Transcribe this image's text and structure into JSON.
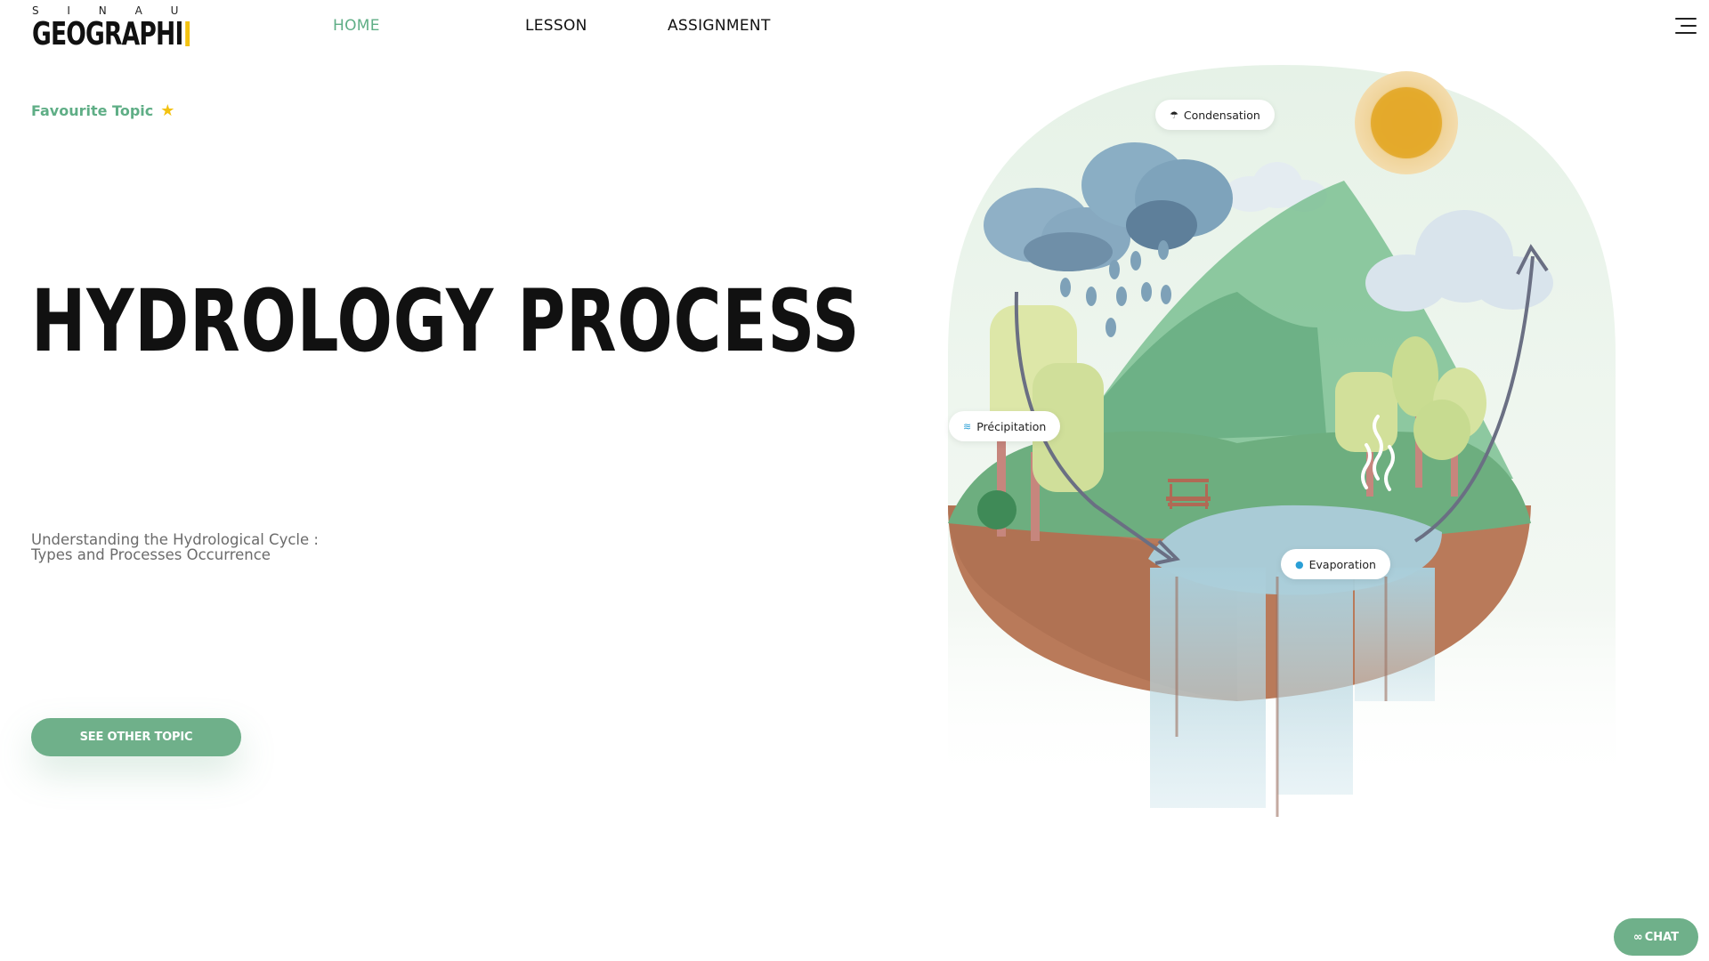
{
  "brand": {
    "top": "S I N A U",
    "main": "GEOGRAPHI"
  },
  "nav": {
    "items": [
      "HOME",
      "LESSON",
      "ASSIGNMENT"
    ],
    "active": "HOME"
  },
  "favourite": {
    "label": "Favourite Topic",
    "icon": "star-icon"
  },
  "hero": {
    "title": "HYDROLOGY PROCESS",
    "subtitle_line1": "Understanding the Hydrological Cycle :",
    "subtitle_line2": "Types and Processes Occurrence",
    "cta": "SEE OTHER TOPIC"
  },
  "illustration": {
    "labels": {
      "condensation": "Condensation",
      "precipitation": "Précipitation",
      "evaporation": "Evaporation"
    }
  },
  "chat": {
    "label": "CHAT"
  },
  "colors": {
    "accent": "#6fb08a",
    "brand_bar": "#f3c211",
    "sun": "#e3a92a"
  }
}
